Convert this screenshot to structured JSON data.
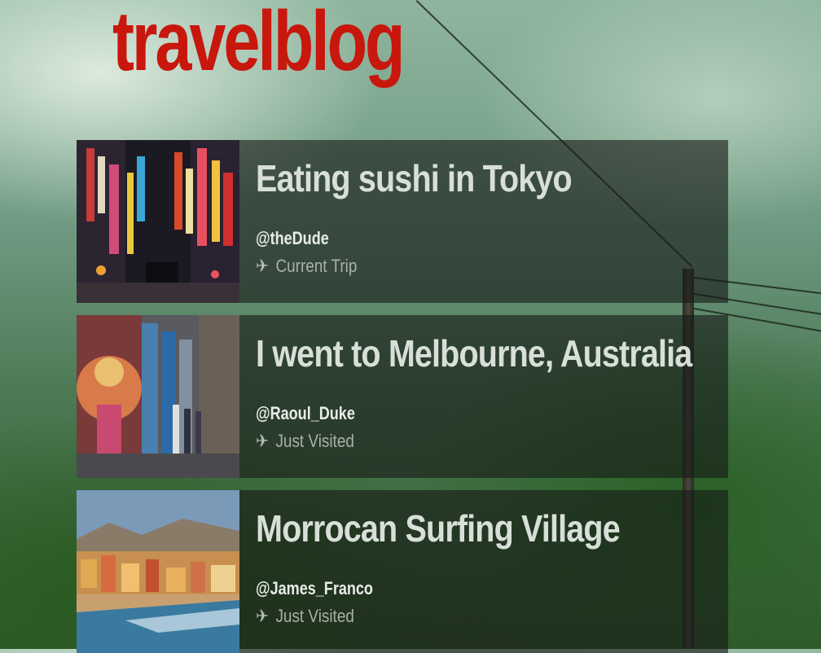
{
  "site": {
    "logo": "travelblog"
  },
  "posts": [
    {
      "title": "Eating sushi in Tokyo",
      "author": "@theDude",
      "status": "Current Trip",
      "thumbnail": "tokyo-neon-street",
      "icon": "plane-icon"
    },
    {
      "title": "I went to Melbourne, Australia",
      "author": "@Raoul_Duke",
      "status": "Just Visited",
      "thumbnail": "melbourne-graffiti-lane",
      "icon": "plane-icon"
    },
    {
      "title": "Morrocan Surfing Village",
      "author": "@James_Franco",
      "status": "Just Visited",
      "thumbnail": "moroccan-beach-village",
      "icon": "plane-icon"
    }
  ],
  "colors": {
    "logo": "#c8170d",
    "card_overlay": "rgba(22,26,22,0.62)"
  }
}
